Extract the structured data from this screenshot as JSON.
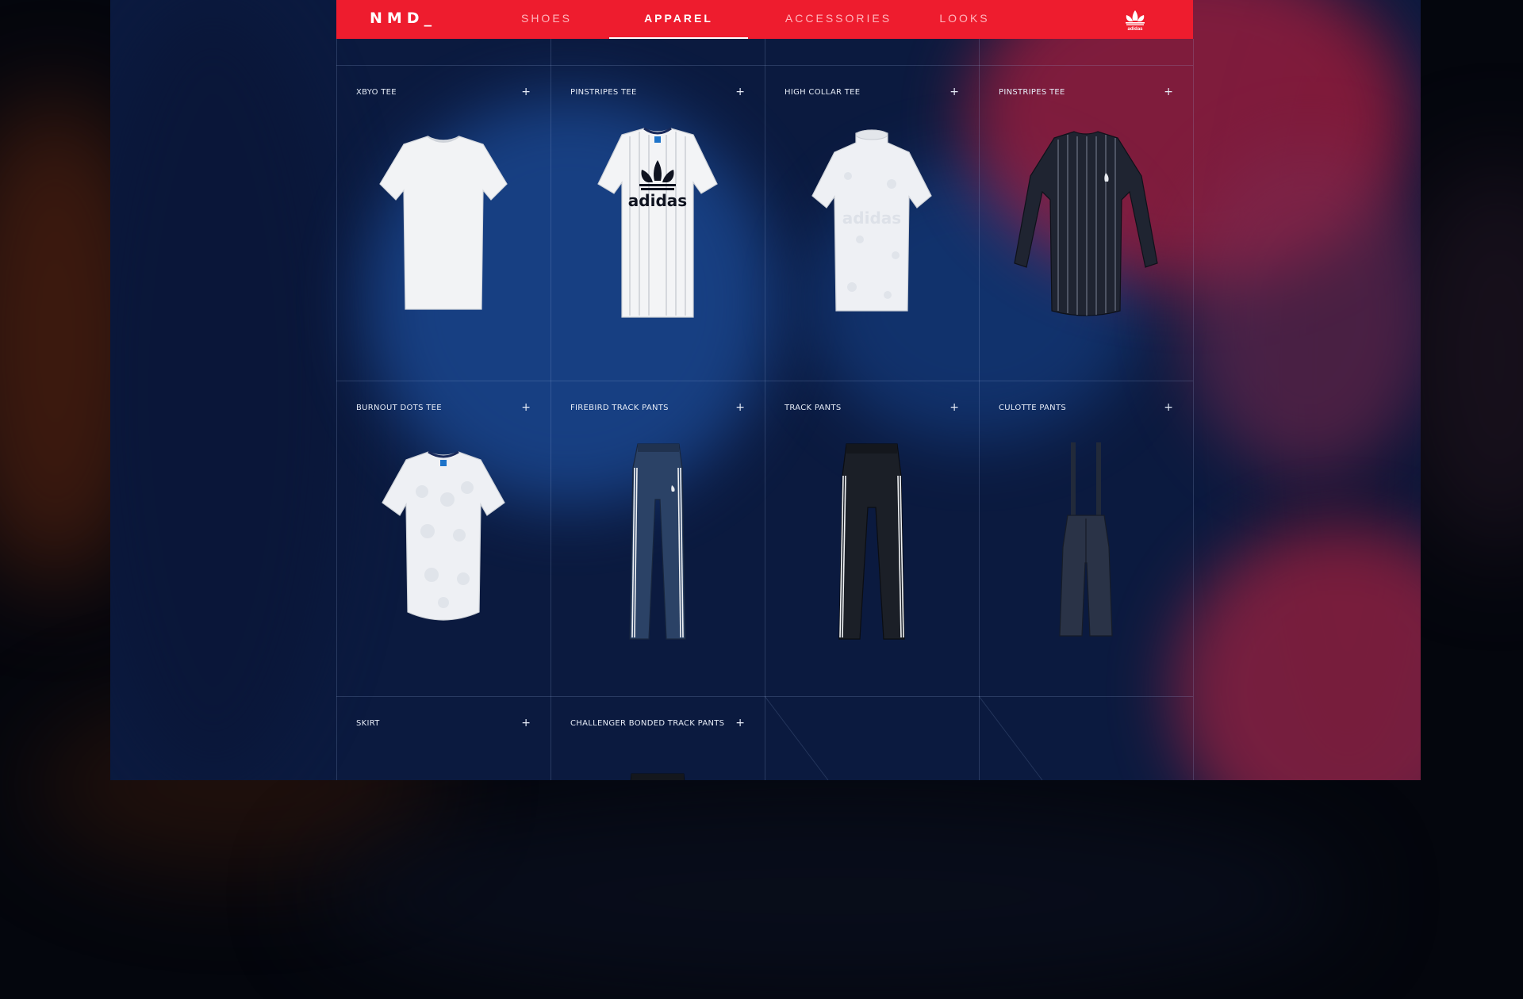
{
  "site": {
    "logo": "NMD_",
    "nav": [
      {
        "label": "SHOES",
        "active": false
      },
      {
        "label": "APPAREL",
        "active": true
      },
      {
        "label": "ACCESSORIES",
        "active": false
      },
      {
        "label": "LOOKS",
        "active": false
      }
    ],
    "brand_icon": "adidas-trefoil-icon",
    "brand_word": "adidas",
    "accent_color": "#ee1c2e"
  },
  "products": [
    {
      "name": "XBYO TEE",
      "icon": "plus-icon",
      "image": "white-tee"
    },
    {
      "name": "PINSTRIPES TEE",
      "icon": "plus-icon",
      "image": "white-pinstripe-tee",
      "print": "adidas"
    },
    {
      "name": "HIGH COLLAR TEE",
      "icon": "plus-icon",
      "image": "white-high-collar-tee",
      "print": "adidas"
    },
    {
      "name": "PINSTRIPES TEE",
      "icon": "plus-icon",
      "image": "navy-pinstripe-longsleeve"
    },
    {
      "name": "BURNOUT DOTS TEE",
      "icon": "plus-icon",
      "image": "white-dots-tee"
    },
    {
      "name": "FIREBIRD TRACK PANTS",
      "icon": "plus-icon",
      "image": "navy-track-pants"
    },
    {
      "name": "TRACK PANTS",
      "icon": "plus-icon",
      "image": "black-track-pants"
    },
    {
      "name": "CULOTTE PANTS",
      "icon": "plus-icon",
      "image": "navy-culotte-pants"
    },
    {
      "name": "SKIRT",
      "icon": "plus-icon",
      "image": ""
    },
    {
      "name": "CHALLENGER BONDED TRACK PANTS",
      "icon": "plus-icon",
      "image": "black-track-pants-partial"
    }
  ]
}
